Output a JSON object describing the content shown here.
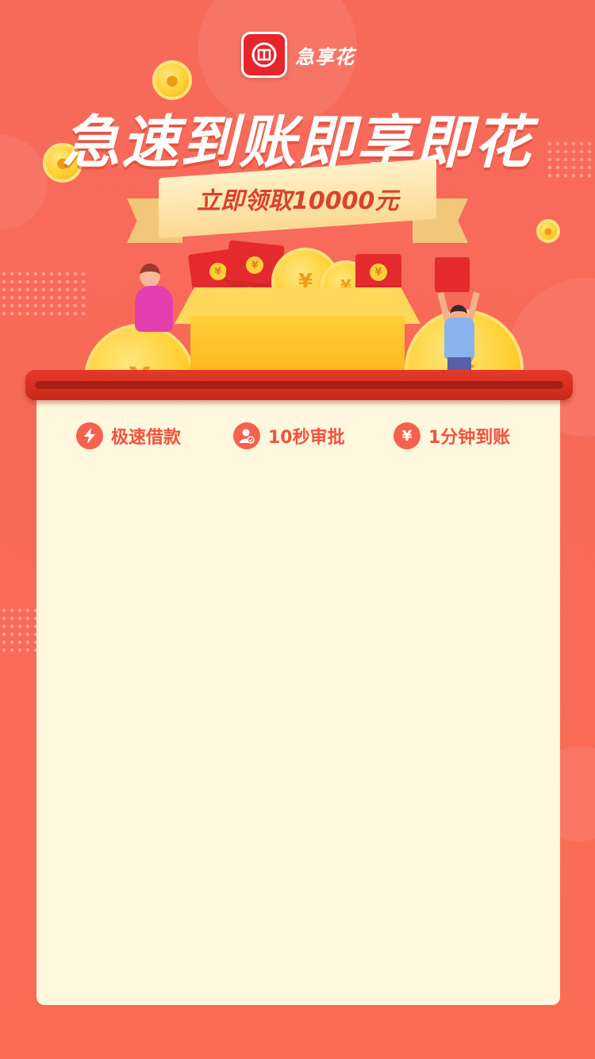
{
  "brand": {
    "name": "急享花",
    "logo_icon": "coin-seal-icon",
    "logo_color": "#e8232b"
  },
  "hero": {
    "headline": "急速到账即享即花",
    "ribbon": "立即领取10000元"
  },
  "features": [
    {
      "icon": "lightning-icon",
      "label": "极速借款"
    },
    {
      "icon": "user-check-icon",
      "label": "10秒审批"
    },
    {
      "icon": "yen-icon",
      "glyph": "¥",
      "label": "1分钟到账"
    }
  ],
  "colors": {
    "background": "#f8675a",
    "panel": "#fff7de",
    "accent": "#f0533f",
    "scroll_bar": "#d52f20",
    "coin": "#ffcf2e"
  }
}
